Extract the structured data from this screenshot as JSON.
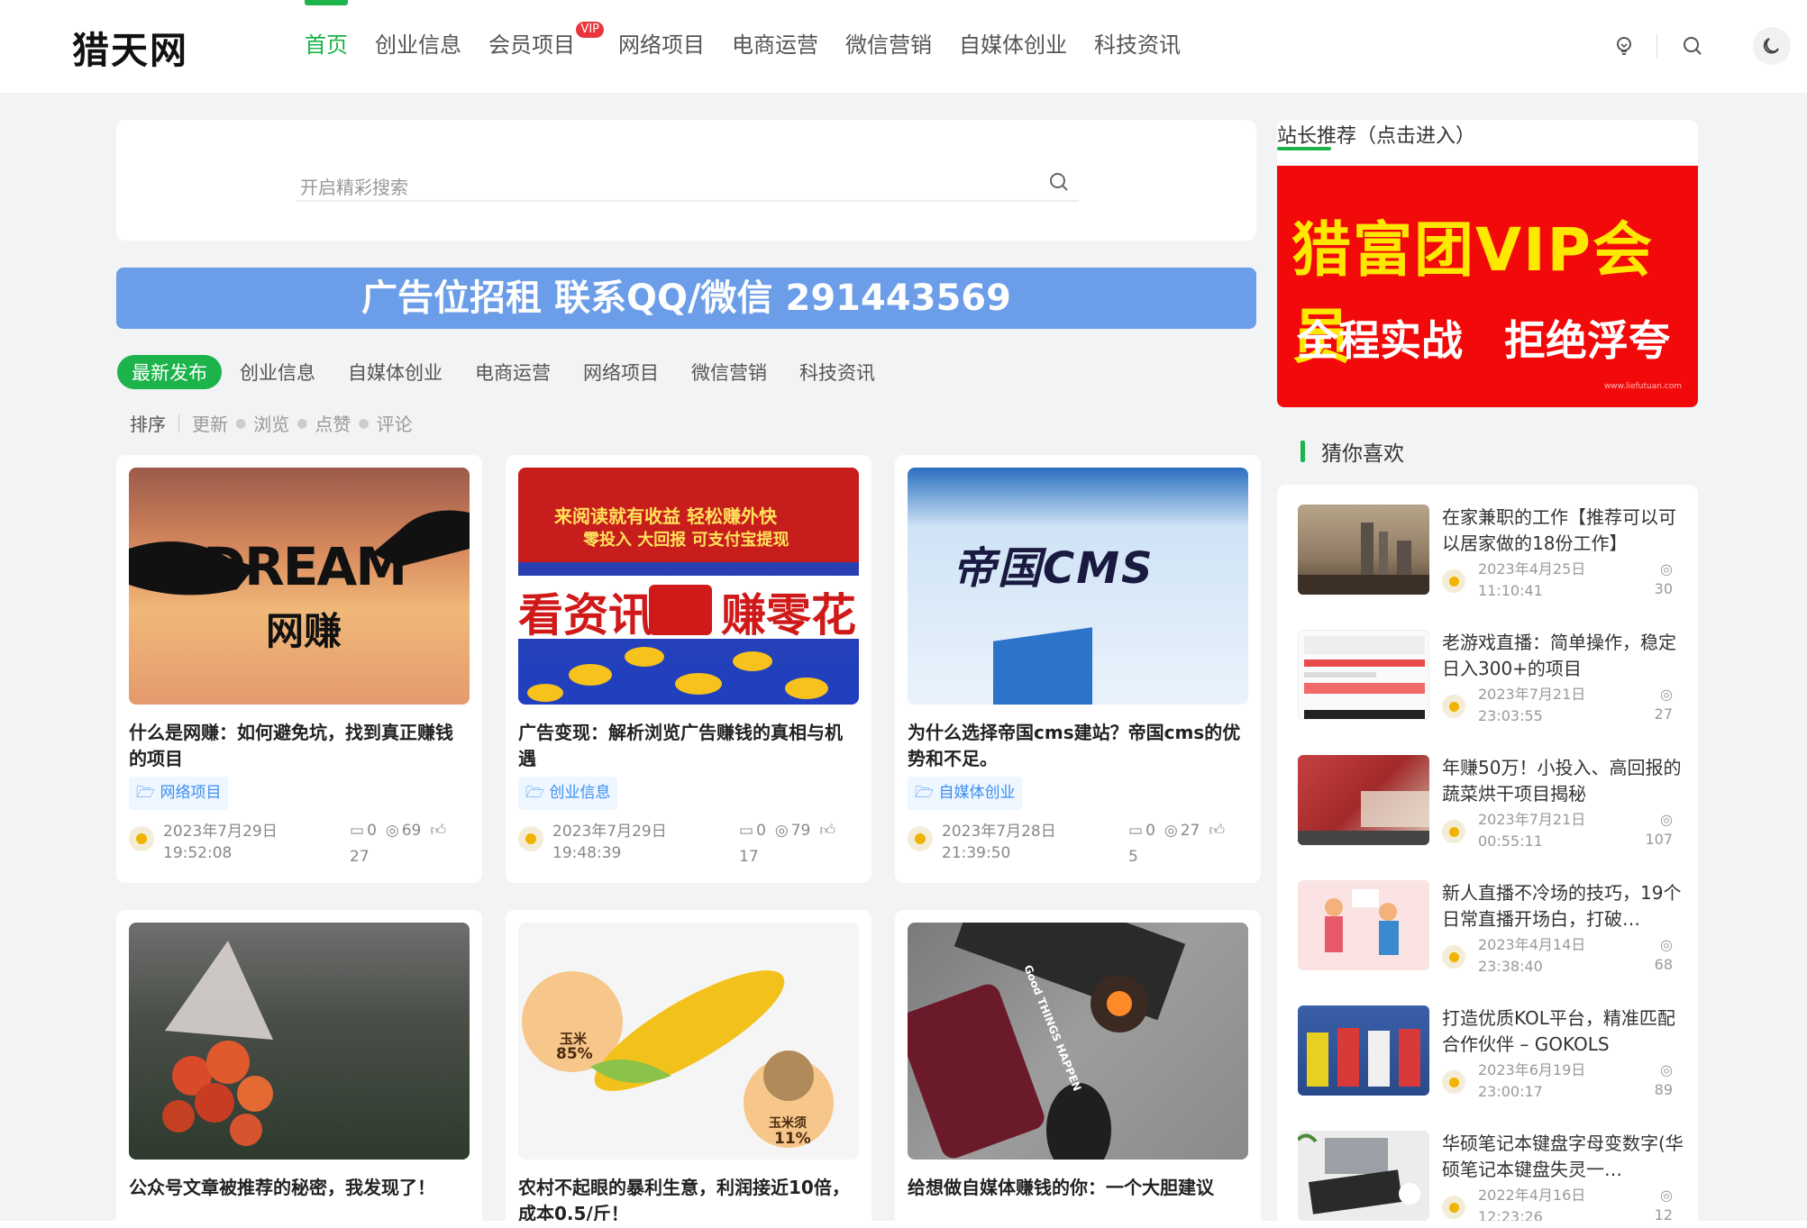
{
  "site": {
    "logo": "猎天网"
  },
  "nav": [
    {
      "label": "首页",
      "active": true
    },
    {
      "label": "创业信息"
    },
    {
      "label": "会员项目",
      "badge": "VIP"
    },
    {
      "label": "网络项目"
    },
    {
      "label": "电商运营"
    },
    {
      "label": "微信营销"
    },
    {
      "label": "自媒体创业"
    },
    {
      "label": "科技资讯"
    }
  ],
  "search": {
    "placeholder": "开启精彩搜索"
  },
  "ad_banner": "广告位招租 联系QQ/微信 291443569",
  "category_tabs": [
    "最新发布",
    "创业信息",
    "自媒体创业",
    "电商运营",
    "网络项目",
    "微信营销",
    "科技资讯"
  ],
  "sort": {
    "label": "排序",
    "options": [
      "更新",
      "浏览",
      "点赞",
      "评论"
    ]
  },
  "posts": [
    {
      "title": "什么是网赚：如何避免坑，找到真正赚钱的项目",
      "category": "网络项目",
      "date": "2023年7月29日",
      "time": "19:52:08",
      "comments": "0",
      "views": "69",
      "likes": "27",
      "image_text_1": "DREAM",
      "image_text_2": "网赚"
    },
    {
      "title": "广告变现：解析浏览广告赚钱的真相与机遇",
      "category": "创业信息",
      "date": "2023年7月29日",
      "time": "19:48:39",
      "comments": "0",
      "views": "79",
      "likes": "17",
      "image_text_1": "来阅读就有收益 轻松赚外快",
      "image_text_2": "零投入 大回报 可支付宝提现",
      "image_text_3": "看资讯",
      "image_text_4": "赚零花"
    },
    {
      "title": "为什么选择帝国cms建站？帝国cms的优势和不足。",
      "category": "自媒体创业",
      "date": "2023年7月28日",
      "time": "21:39:50",
      "comments": "0",
      "views": "27",
      "likes": "5",
      "image_text_1": "帝国CMS"
    },
    {
      "title": "公众号文章被推荐的秘密，我发现了！"
    },
    {
      "title": "农村不起眼的暴利生意，利润接近10倍，成本0.5/斤！",
      "image_text_1": "玉米",
      "image_text_2": "85%",
      "image_text_3": "玉米须",
      "image_text_4": "11%"
    },
    {
      "title": "给想做自媒体赚钱的你：一个大胆建议",
      "image_text_1": "Good THINGS HAPPEN"
    }
  ],
  "sidebar": {
    "recommend_title": "站长推荐（点击进入）",
    "vip_ad": {
      "title": "猎富团VIP会员",
      "sub1": "全程实战",
      "sub2": "拒绝浮夸",
      "url": "www.liefutuan.com"
    },
    "guess_title": "猜你喜欢",
    "guess": [
      {
        "title": "在家兼职的工作【推荐可以可以居家做的18份工作】",
        "date": "2023年4月25日",
        "time": "11:10:41",
        "views": "30"
      },
      {
        "title": "老游戏直播：简单操作，稳定日入300+的项目",
        "date": "2023年7月21日",
        "time": "23:03:55",
        "views": "27"
      },
      {
        "title": "年赚50万！小投入、高回报的蔬菜烘干项目揭秘",
        "date": "2023年7月21日",
        "time": "00:55:11",
        "views": "107"
      },
      {
        "title": "新人直播不冷场的技巧，19个日常直播开场白，打破…",
        "date": "2023年4月14日",
        "time": "23:38:40",
        "views": "68"
      },
      {
        "title": "打造优质KOL平台，精准匹配合作伙伴 – GOKOLS",
        "date": "2023年6月19日",
        "time": "23:00:17",
        "views": "89"
      },
      {
        "title": "华硕笔记本键盘字母变数字(华硕笔记本键盘失灵一…",
        "date": "2022年4月16日",
        "time": "12:23:26",
        "views": "12"
      }
    ]
  }
}
